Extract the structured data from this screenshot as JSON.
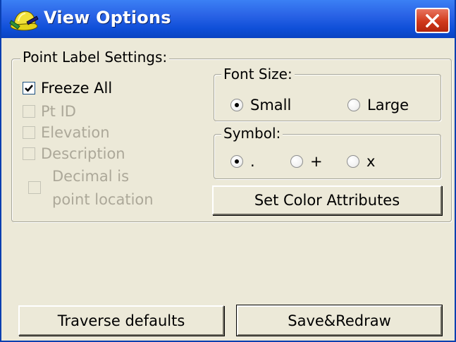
{
  "window": {
    "title": "View Options"
  },
  "point_label": {
    "legend": "Point Label Settings:",
    "freeze_all": {
      "label": "Freeze All",
      "checked": true,
      "enabled": true
    },
    "pt_id": {
      "label": "Pt ID",
      "checked": false,
      "enabled": false
    },
    "elevation": {
      "label": "Elevation",
      "checked": false,
      "enabled": false
    },
    "description": {
      "label": "Description",
      "checked": false,
      "enabled": false
    },
    "decimal": {
      "label_line1": "Decimal is",
      "label_line2": "point location",
      "checked": false,
      "enabled": false
    }
  },
  "font_size": {
    "legend": "Font Size:",
    "options": [
      {
        "label": "Small",
        "selected": true
      },
      {
        "label": "Large",
        "selected": false
      }
    ]
  },
  "symbol": {
    "legend": "Symbol:",
    "options": [
      {
        "label": ".",
        "selected": true
      },
      {
        "label": "+",
        "selected": false
      },
      {
        "label": "x",
        "selected": false
      }
    ]
  },
  "buttons": {
    "set_color": "Set Color Attributes",
    "traverse_defaults": "Traverse defaults",
    "save_redraw": "Save&Redraw"
  },
  "colors": {
    "title_bar": "#0f4fd8",
    "close_button": "#d0391b",
    "dialog_bg": "#ece9d8",
    "disabled_text": "#aca899"
  },
  "icons": {
    "app": "hardhat-icon",
    "close": "close-icon",
    "check": "checkmark-icon"
  }
}
